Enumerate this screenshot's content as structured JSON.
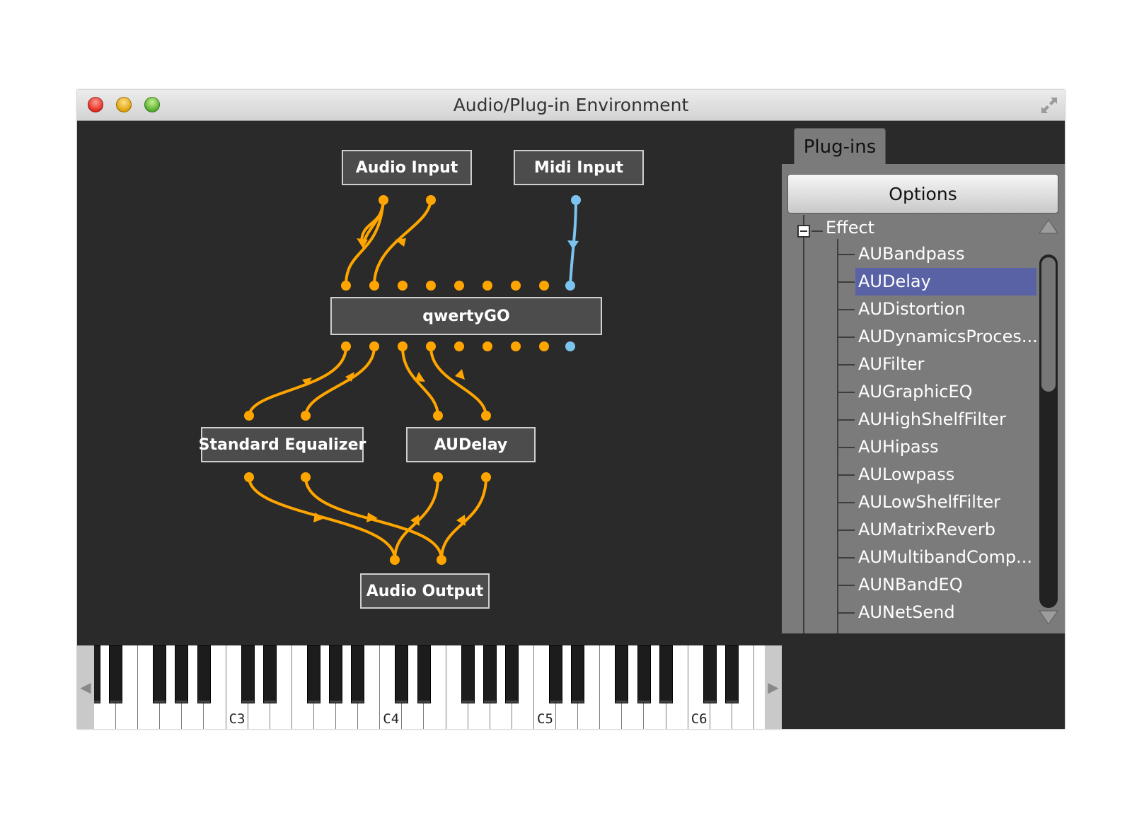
{
  "window": {
    "title": "Audio/Plug-in Environment"
  },
  "graph": {
    "nodes": {
      "audio_input": "Audio Input",
      "midi_input": "Midi Input",
      "qwertygo": "qwertyGO",
      "standard_eq": "Standard Equalizer",
      "audelay": "AUDelay",
      "audio_output": "Audio Output"
    },
    "colors": {
      "audio_wire": "#ffa500",
      "midi_wire": "#7cc4f0"
    }
  },
  "keyboard": {
    "labels": [
      "C3",
      "C4",
      "C5",
      "C6"
    ],
    "left_arrow": "◀",
    "right_arrow": "▶"
  },
  "plugins_panel": {
    "tab_label": "Plug-ins",
    "options_label": "Options",
    "tree": {
      "root": "Effect",
      "items": [
        "AUBandpass",
        "AUDelay",
        "AUDistortion",
        "AUDynamicsProces...",
        "AUFilter",
        "AUGraphicEQ",
        "AUHighShelfFilter",
        "AUHipass",
        "AULowpass",
        "AULowShelfFilter",
        "AUMatrixReverb",
        "AUMultibandComp...",
        "AUNBandEQ",
        "AUNetSend"
      ],
      "selected_item": "AUDelay",
      "selection_color": "#5a62a6"
    }
  }
}
